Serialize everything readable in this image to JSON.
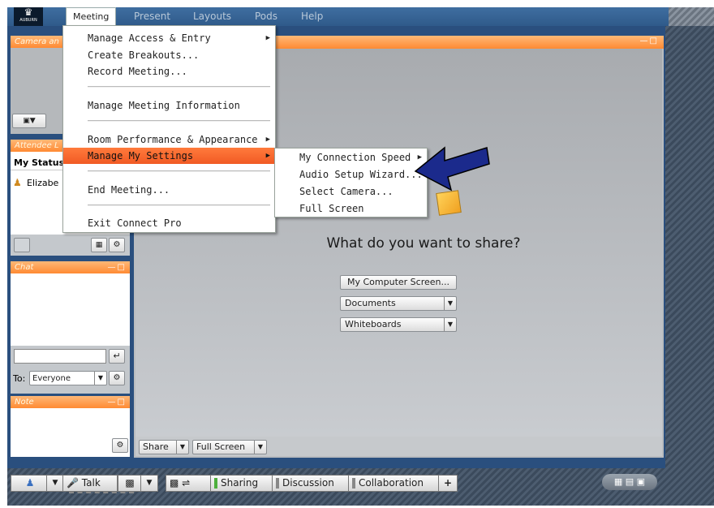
{
  "app": {
    "logo_text": "AUBURN"
  },
  "menubar": {
    "items": [
      "Meeting",
      "Present",
      "Layouts",
      "Pods",
      "Help"
    ]
  },
  "meeting_menu": {
    "items": [
      {
        "label": "Manage Access & Entry",
        "submenu": true
      },
      {
        "label": "Create Breakouts...",
        "submenu": false
      },
      {
        "label": "Record Meeting...",
        "submenu": false
      },
      {
        "label": "Manage Meeting Information",
        "submenu": false
      },
      {
        "label": "Room Performance & Appearance",
        "submenu": true
      },
      {
        "label": "Manage My Settings",
        "submenu": true,
        "highlighted": true
      },
      {
        "label": "End Meeting...",
        "submenu": false
      },
      {
        "label": "Exit Connect Pro",
        "submenu": false
      }
    ]
  },
  "settings_submenu": {
    "items": [
      {
        "label": "My Connection Speed",
        "submenu": true
      },
      {
        "label": "Audio Setup Wizard...",
        "submenu": false
      },
      {
        "label": "Select Camera...",
        "submenu": false
      },
      {
        "label": "Full Screen",
        "submenu": false
      }
    ]
  },
  "camera_pod": {
    "title": "Camera an"
  },
  "attendee_pod": {
    "title": "Attendee L",
    "header": "My Status",
    "attendee_name": "Elizabe"
  },
  "chat_pod": {
    "title": "Chat",
    "to_label": "To:",
    "to_value": "Everyone",
    "message_placeholder": ""
  },
  "note_pod": {
    "title": "Note"
  },
  "share_pod": {
    "question": "What do you want to share?",
    "my_computer_button": "My Computer Screen...",
    "documents_label": "Documents",
    "whiteboards_label": "Whiteboards",
    "share_label": "Share",
    "full_screen_label": "Full Screen"
  },
  "bottom_bar": {
    "talk_label": "Talk",
    "layouts": [
      "Sharing",
      "Discussion",
      "Collaboration"
    ],
    "add_label": "+"
  },
  "colors": {
    "accent_orange": "#f15a24",
    "pod_title": "#ff8a33",
    "frame_blue": "#213c5a",
    "arrow_blue": "#1b2a8c"
  }
}
